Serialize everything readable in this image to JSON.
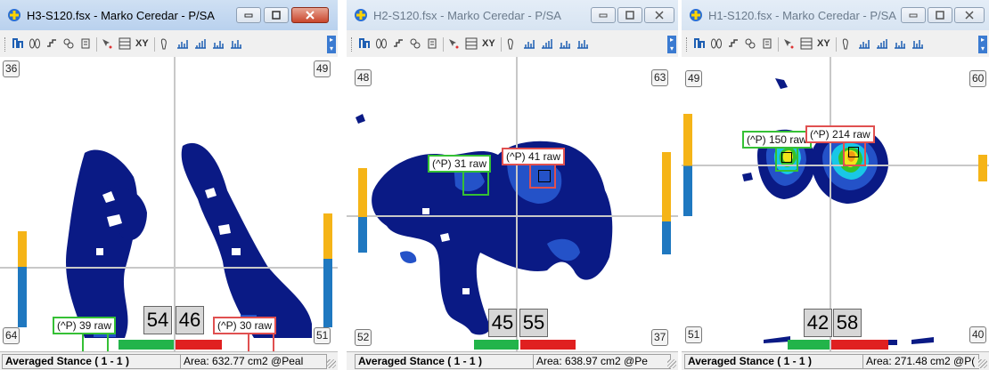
{
  "colors": {
    "title_active": "#b9d1ee",
    "footprint_dark": "#0a1a85",
    "footprint_mid": "#2452c8",
    "pressure_cyan": "#19c7e6",
    "pressure_green": "#34c22a",
    "pressure_yellow": "#f2e51a",
    "pressure_orange": "#f29a13",
    "left_marker": "#35c035",
    "right_marker": "#e02020",
    "side_top": "#f5b417",
    "side_bottom": "#1f78c0"
  },
  "toolbar_icons": [
    "zoom-icon",
    "footprints-icon",
    "steps-icon",
    "layers-icon",
    "sensor-icon",
    "cursor-icon",
    "grid-icon",
    "xy-label",
    "foot-icon",
    "chart1-icon",
    "chart2-icon",
    "chart3-icon",
    "chart4-icon"
  ],
  "toolbar_xy": "XY",
  "windows": [
    {
      "title": "H3-S120.fsx - Marko Ceredar - P/SA",
      "state": "active",
      "corners": {
        "tl": "36",
        "tr": "49",
        "bl": "64",
        "br": "51"
      },
      "left_cop": "(^P) 39 raw",
      "right_cop": "(^P) 30 raw",
      "left_pct": "54",
      "right_pct": "46",
      "status_stance": "Averaged Stance ( 1 - 1 )",
      "status_area": "Area: 632.77 cm2 @Peal"
    },
    {
      "title": "H2-S120.fsx - Marko Ceredar - P/SA",
      "state": "inactive",
      "corners": {
        "tl": "48",
        "tr": "63",
        "bl": "52",
        "br": "37"
      },
      "left_cop": "(^P) 31 raw",
      "right_cop": "(^P) 41 raw",
      "left_pct": "45",
      "right_pct": "55",
      "status_stance": "Averaged Stance ( 1 - 1 )",
      "status_area": "Area: 638.97 cm2 @Pe"
    },
    {
      "title": "H1-S120.fsx - Marko Ceredar - P/SA",
      "state": "inactive",
      "corners": {
        "tl": "49",
        "tr": "60",
        "bl": "51",
        "br": "40"
      },
      "left_cop": "(^P) 150 raw",
      "right_cop": "(^P) 214 raw",
      "left_pct": "42",
      "right_pct": "58",
      "status_stance": "Averaged Stance ( 1 - 1 )",
      "status_area": "Area: 271.48 cm2 @P("
    }
  ]
}
